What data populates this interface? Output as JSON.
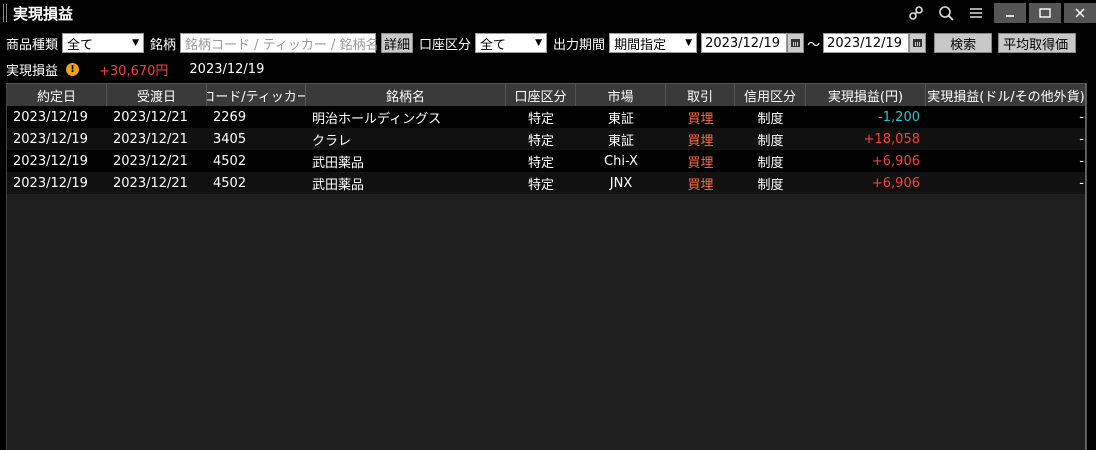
{
  "window": {
    "title": "実現損益",
    "icons": [
      "link-icon",
      "search-icon",
      "menu-icon"
    ],
    "controls": [
      "minimize",
      "maximize",
      "close"
    ]
  },
  "filters": {
    "product_type_label": "商品種類",
    "product_type_value": "全て",
    "symbol_label": "銘柄",
    "symbol_placeholder": "銘柄コード / ティッカー / 銘柄名",
    "detail_button": "詳細",
    "account_label": "口座区分",
    "account_value": "全て",
    "period_label": "出力期間",
    "period_value": "期間指定",
    "date_from": "2023/12/19",
    "date_sep": "～",
    "date_to": "2023/12/19",
    "search_button": "検索",
    "avg_button": "平均取得価"
  },
  "summary": {
    "label": "実現損益",
    "warn_symbol": "!",
    "amount": "+30,670円",
    "date": "2023/12/19"
  },
  "table": {
    "headers": [
      "約定日",
      "受渡日",
      "コード/ティッカー",
      "銘柄名",
      "口座区分",
      "市場",
      "取引",
      "信用区分",
      "実現損益(円)",
      "実現損益(ドル/その他外貨)"
    ],
    "rows": [
      [
        "2023/12/19",
        "2023/12/21",
        "2269",
        "明治ホールディングス",
        "特定",
        "東証",
        "買埋",
        "制度",
        "-1,200",
        "-"
      ],
      [
        "2023/12/19",
        "2023/12/21",
        "3405",
        "クラレ",
        "特定",
        "東証",
        "買埋",
        "制度",
        "+18,058",
        "-"
      ],
      [
        "2023/12/19",
        "2023/12/21",
        "4502",
        "武田薬品",
        "特定",
        "Chi-X",
        "買埋",
        "制度",
        "+6,906",
        "-"
      ],
      [
        "2023/12/19",
        "2023/12/21",
        "4502",
        "武田薬品",
        "特定",
        "JNX",
        "買埋",
        "制度",
        "+6,906",
        "-"
      ]
    ]
  },
  "colors": {
    "profit": "#ff3b3b",
    "loss": "#22c8d0",
    "trade_buy": "#ff6a3c",
    "header_bg": "#3a3a3a"
  }
}
